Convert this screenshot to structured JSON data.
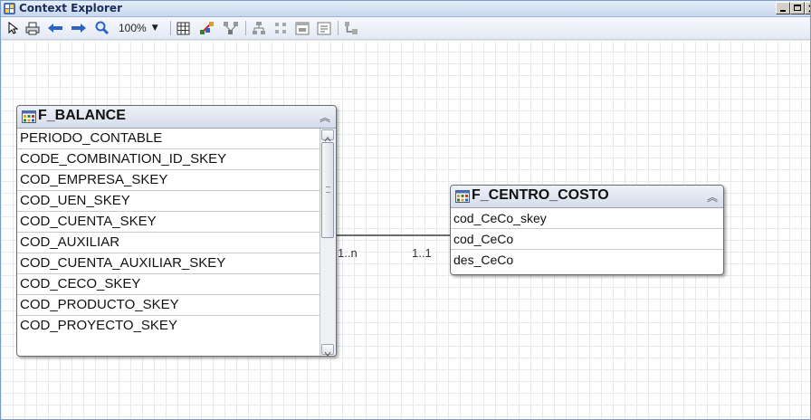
{
  "window": {
    "title": "Context Explorer"
  },
  "toolbar": {
    "zoom_label": "100%",
    "buttons": [
      "pointer-icon",
      "print-icon",
      "back-arrow-icon",
      "forward-arrow-icon",
      "zoom-icon",
      "grid-icon",
      "auto-layout-icon",
      "hierarchical-layout-icon",
      "tree-layout-icon",
      "radial-layout-icon",
      "window-icon",
      "properties-icon",
      "relationship-icon"
    ]
  },
  "entities": {
    "f_balance": {
      "title": "F_BALANCE",
      "fields": [
        "PERIODO_CONTABLE",
        "CODE_COMBINATION_ID_SKEY",
        "COD_EMPRESA_SKEY",
        "COD_UEN_SKEY",
        "COD_CUENTA_SKEY",
        "COD_AUXILIAR",
        "COD_CUENTA_AUXILIAR_SKEY",
        "COD_CECO_SKEY",
        "COD_PRODUCTO_SKEY",
        "COD_PROYECTO_SKEY"
      ]
    },
    "f_centro_costo": {
      "title": "F_CENTRO_COSTO",
      "fields": [
        "cod_CeCo_skey",
        "cod_CeCo",
        "des_CeCo"
      ]
    }
  },
  "relationship": {
    "left_cardinality": "1..n",
    "right_cardinality": "1..1"
  },
  "colors": {
    "title_text": "#1b2e5a",
    "grid_line": "#e6e9ee",
    "entity_border": "#6c6c6c"
  }
}
